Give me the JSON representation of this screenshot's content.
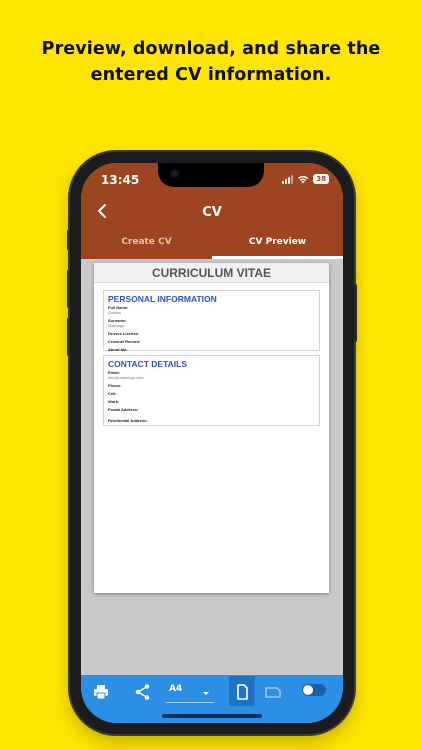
{
  "promo": {
    "headline_line1": "Preview, download, and share the",
    "headline_line2": "entered CV information."
  },
  "status_bar": {
    "time": "13:45",
    "battery": "38"
  },
  "app_bar": {
    "title": "CV",
    "tabs": [
      {
        "label": "Create CV",
        "active": false
      },
      {
        "label": "CV Preview",
        "active": true
      }
    ],
    "color": "#9C4520"
  },
  "document": {
    "title": "CURRICULUM VITAE",
    "sections": [
      {
        "heading": "PERSONAL INFORMATION",
        "fields": [
          {
            "label": "Full Name:",
            "value": "Golden"
          },
          {
            "label": "Surname:",
            "value": "Mashego"
          },
          {
            "label": "Drivers License:",
            "value": ""
          },
          {
            "label": "Criminal Record:",
            "value": ""
          },
          {
            "label": "About Me:",
            "value": ""
          }
        ]
      },
      {
        "heading": "CONTACT DETAILS",
        "fields": [
          {
            "label": "Email:",
            "value": "info@mashego.com"
          },
          {
            "label": "Phone:",
            "value": ""
          },
          {
            "label": "Cell:",
            "value": ""
          },
          {
            "label": "Work:",
            "value": ""
          },
          {
            "label": "Postal Address:",
            "value": ""
          },
          {
            "label": "Residential Address:",
            "value": ""
          }
        ]
      }
    ]
  },
  "toolbar": {
    "paper_size": "A4",
    "color": "#2B8FE5",
    "icons": [
      "print-icon",
      "share-icon",
      "dropdown-icon",
      "portrait-page-icon",
      "landscape-page-icon",
      "toggle-switch"
    ]
  }
}
